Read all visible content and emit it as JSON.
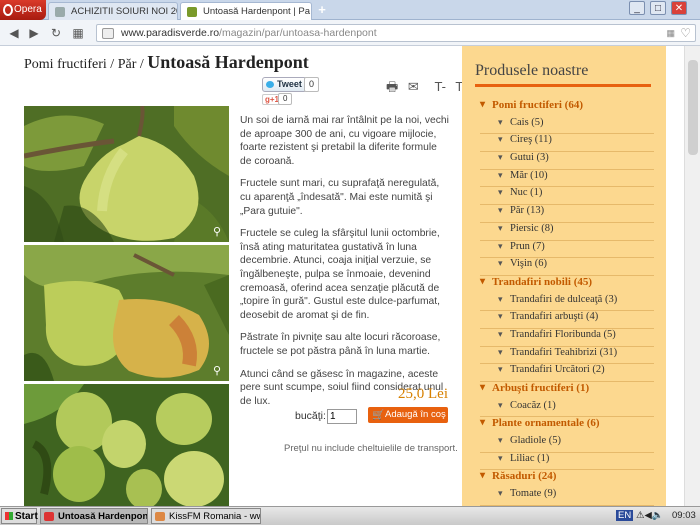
{
  "browser": {
    "opera_label": "Opera",
    "tabs": [
      {
        "title": "ACHIZITII SOIURI NOI 20",
        "active": false
      },
      {
        "title": "Untoasă Hardenpont | Pa",
        "active": true
      }
    ],
    "new_tab": "+",
    "url_host": "www.paradisverde.ro",
    "url_path": "/magazin/par/untoasa-hardenpont"
  },
  "breadcrumb": {
    "path": "Pomi fructiferi / Păr / ",
    "title": "Untoasă Hardenpont"
  },
  "social": {
    "tweet_label": "Tweet",
    "tweet_count": "0",
    "gplus_label": "g+1",
    "gplus_count": "0"
  },
  "tools": {
    "font_smaller": "T-",
    "font_larger": "T+"
  },
  "description": [
    "Un soi de iarnă mai rar întâlnit pe la noi, vechi de aproape 300 de ani, cu vigoare mijlocie, foarte rezistent şi pretabil la diferite formule de coroană.",
    "Fructele sunt mari, cu suprafaţă neregulată, cu aparenţă „îndesată\". Mai este numită şi „Para gutuie\".",
    "Fructele se culeg la sfârşitul lunii octombrie, însă ating maturitatea gustativă în luna decembrie. Atunci, coaja iniţial verzuie, se îngălbeneşte, pulpa se înmoaie, devenind cremoasă, oferind acea senzaţie plăcută de „topire în gură\". Gustul este dulce-parfumat, deosebit de aromat şi de fin.",
    "Păstrate în pivniţe sau alte locuri răcoroase, fructele se pot păstra până în luna martie.",
    "Atunci când se găsesc în magazine, aceste pere sunt scumpe, soiul fiind considerat unul de lux."
  ],
  "price": "25,0 Lei",
  "quantity_label": "bucăţi:",
  "quantity_value": "1",
  "add_to_cart": "Adaugă în coş",
  "shipping_note": "Preţul nu include cheltuielile de transport.",
  "sidebar": {
    "title": "Produsele noastre",
    "items": [
      {
        "type": "cat",
        "label": "Pomi fructiferi (64)"
      },
      {
        "type": "sub",
        "label": "Cais (5)"
      },
      {
        "type": "sub",
        "label": "Cireş (11)"
      },
      {
        "type": "sub",
        "label": "Gutui (3)"
      },
      {
        "type": "sub",
        "label": "Măr (10)"
      },
      {
        "type": "sub",
        "label": "Nuc (1)"
      },
      {
        "type": "sub",
        "label": "Păr (13)"
      },
      {
        "type": "sub",
        "label": "Piersic (8)"
      },
      {
        "type": "sub",
        "label": "Prun (7)"
      },
      {
        "type": "sub",
        "label": "Vişin (6)"
      },
      {
        "type": "cat",
        "label": "Trandafiri nobili (45)"
      },
      {
        "type": "sub",
        "label": "Trandafiri de dulceaţă (3)"
      },
      {
        "type": "sub",
        "label": "Trandafiri arbuşti (4)"
      },
      {
        "type": "sub",
        "label": "Trandafiri Floribunda (5)"
      },
      {
        "type": "sub",
        "label": "Trandafiri Teahibrizi (31)"
      },
      {
        "type": "sub",
        "label": "Trandafiri Urcători (2)"
      },
      {
        "type": "cat",
        "label": "Arbuşti fructiferi (1)"
      },
      {
        "type": "sub",
        "label": "Coacăz (1)"
      },
      {
        "type": "cat",
        "label": "Plante ornamentale (6)"
      },
      {
        "type": "sub",
        "label": "Gladiole (5)"
      },
      {
        "type": "sub",
        "label": "Liliac (1)"
      },
      {
        "type": "cat",
        "label": "Răsaduri (24)"
      },
      {
        "type": "sub",
        "label": "Tomate (9)"
      }
    ]
  },
  "taskbar": {
    "start": "Start",
    "tasks": [
      "Untoasă Hardenpont ...",
      "KissFM Romania - www.k..."
    ],
    "lang": "EN",
    "clock": "09:03"
  },
  "colors": {
    "accent": "#e8610f",
    "sidebar_bg": "#fcd88f",
    "price": "#d78000"
  }
}
